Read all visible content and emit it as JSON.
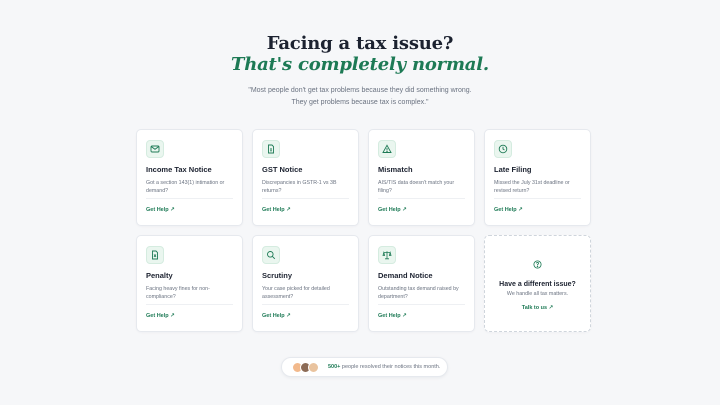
{
  "hero": {
    "title": "Facing a tax issue?",
    "subtitle": "That's completely normal.",
    "quote_line1": "\"Most people don't get tax problems because they did something wrong.",
    "quote_line2": "They get problems because tax is complex.\""
  },
  "cards": [
    {
      "icon": "mail-icon",
      "title": "Income Tax Notice",
      "desc": "Got a section 143(1) intimation or demand?",
      "link": "Get Help ↗"
    },
    {
      "icon": "document-icon",
      "title": "GST Notice",
      "desc": "Discrepancies in GSTR-1 vs 3B returns?",
      "link": "Get Help ↗"
    },
    {
      "icon": "warning-icon",
      "title": "Mismatch",
      "desc": "AIS/TIS data doesn't match your filing?",
      "link": "Get Help ↗"
    },
    {
      "icon": "clock-icon",
      "title": "Late Filing",
      "desc": "Missed the July 31st deadline or revised return?",
      "link": "Get Help ↗"
    },
    {
      "icon": "penalty-icon",
      "title": "Penalty",
      "desc": "Facing heavy fines for non-compliance?",
      "link": "Get Help ↗"
    },
    {
      "icon": "search-icon",
      "title": "Scrutiny",
      "desc": "Your case picked for detailed assessment?",
      "link": "Get Help ↗"
    },
    {
      "icon": "scale-icon",
      "title": "Demand Notice",
      "desc": "Outstanding tax demand raised by department?",
      "link": "Get Help ↗"
    }
  ],
  "different": {
    "icon": "question-icon",
    "title": "Have a different issue?",
    "desc": "We handle all tax matters.",
    "link": "Talk to us ↗"
  },
  "social_proof": {
    "count": "500+",
    "text": "people resolved their notices this month."
  },
  "colors": {
    "accent": "#1d7a55",
    "icon_bg": "#eaf6ef",
    "page_bg": "#f6f7f9"
  }
}
